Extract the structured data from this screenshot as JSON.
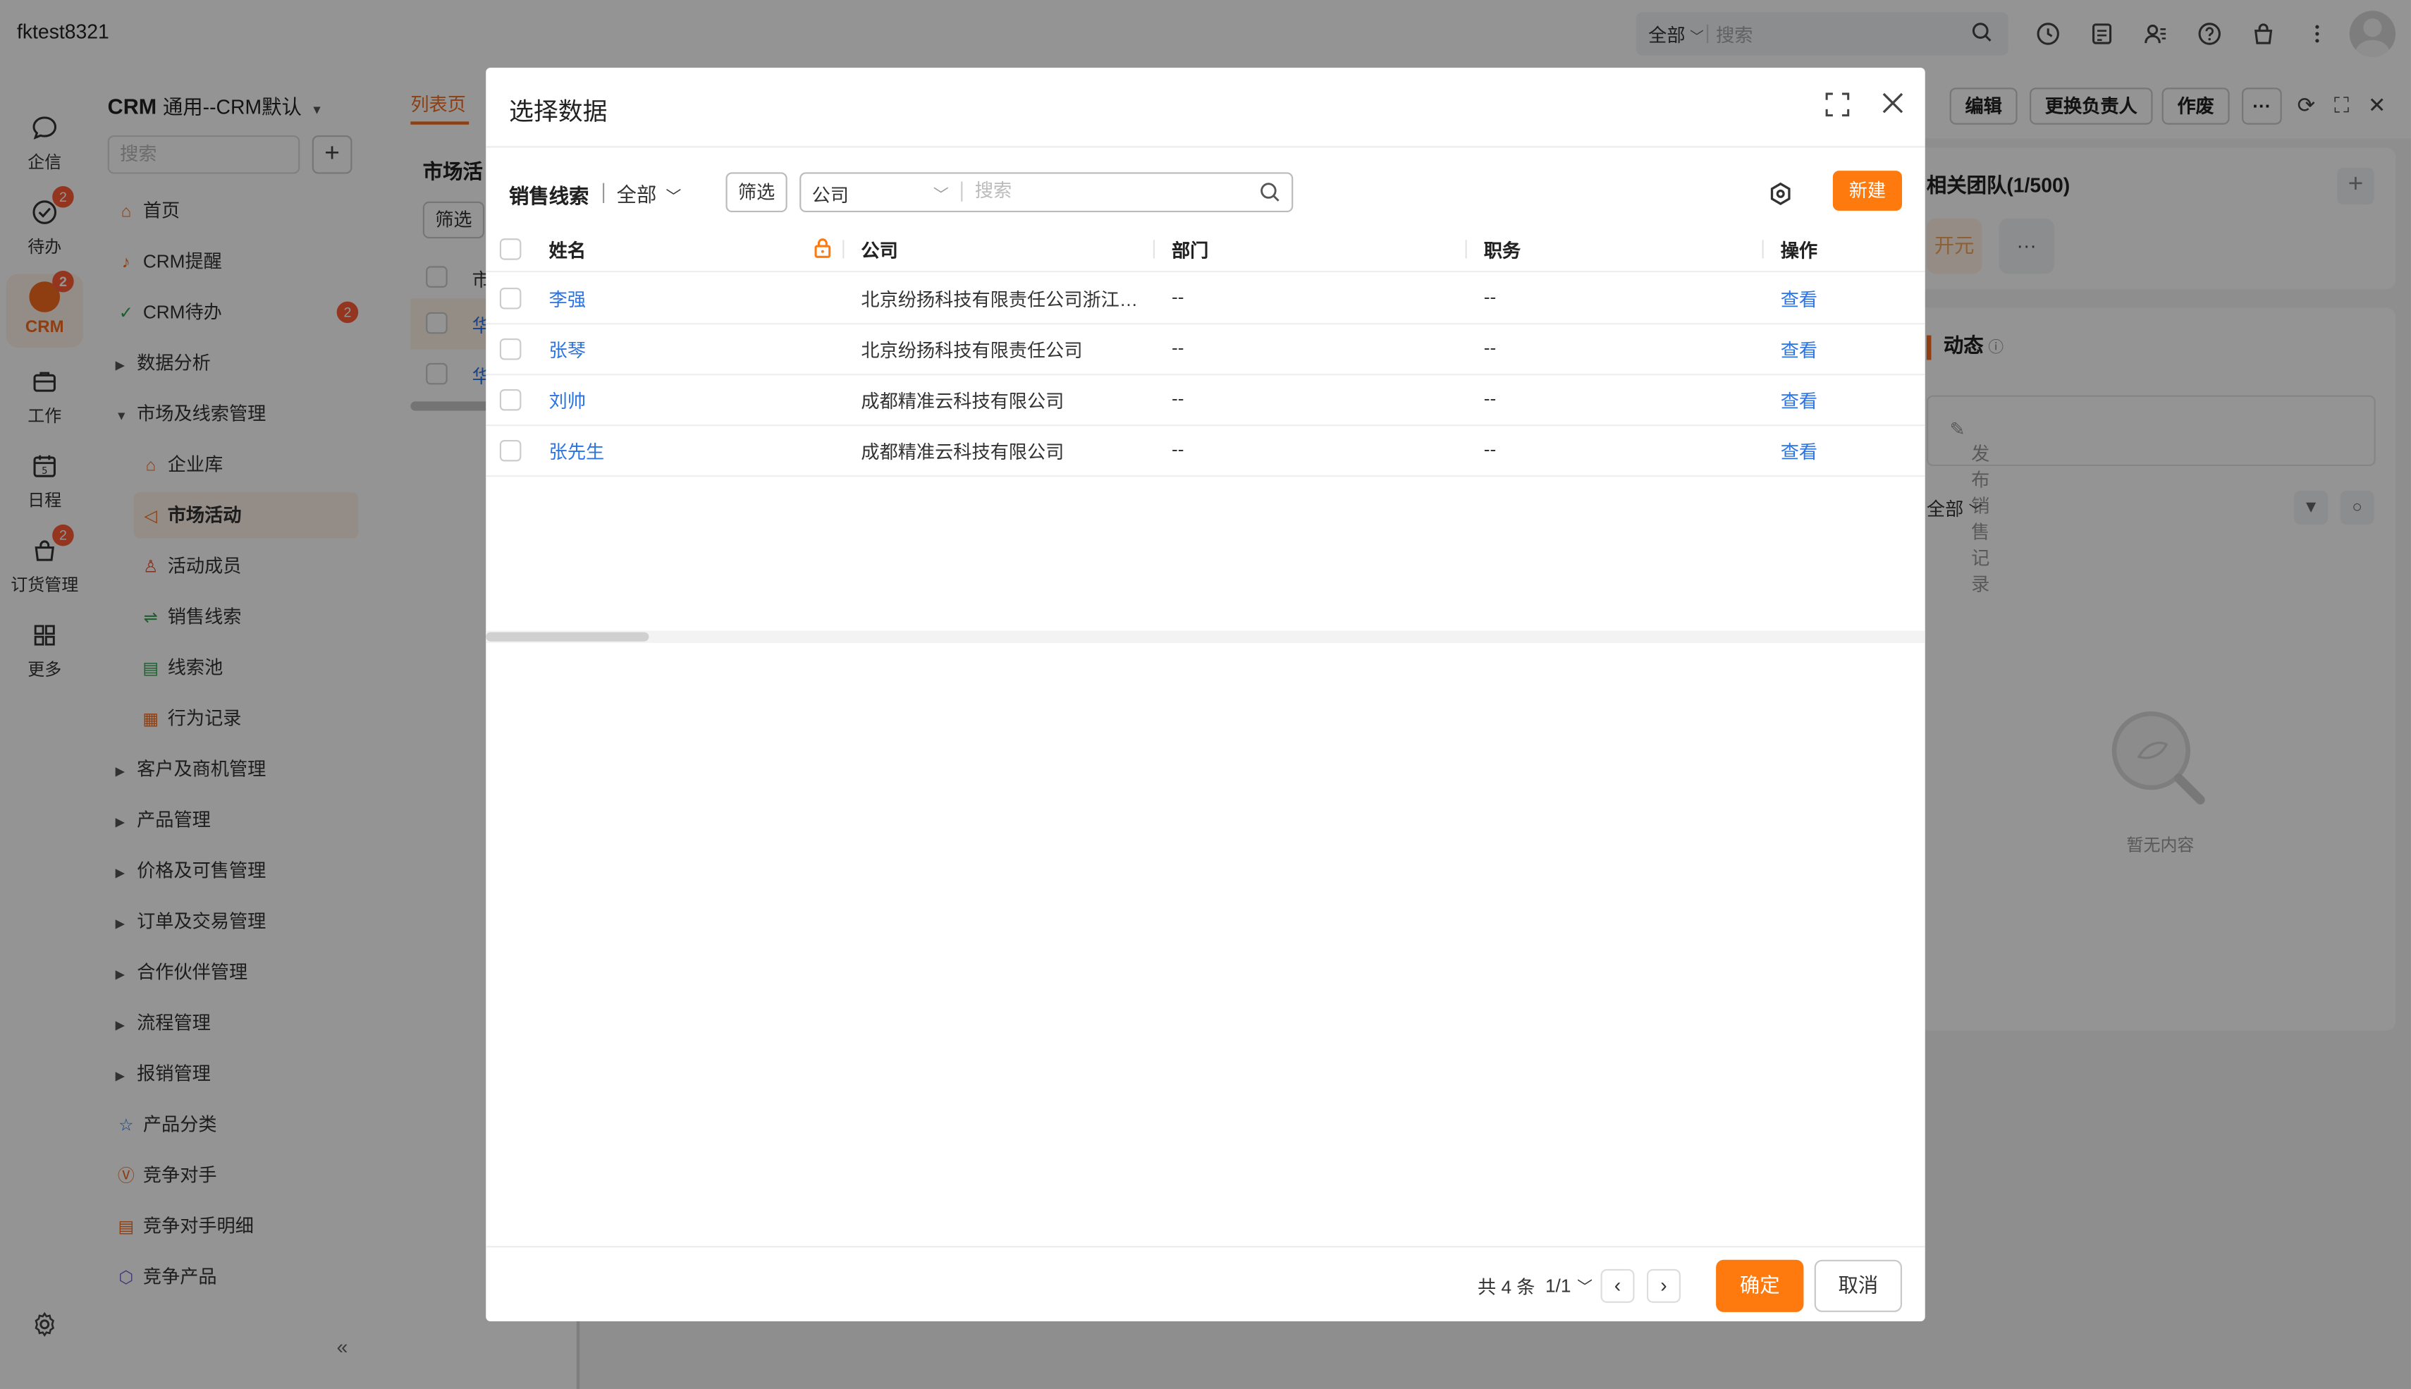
{
  "topbar": {
    "tenant": "fktest8321",
    "search_scope": "全部",
    "search_placeholder": "搜索",
    "icons": [
      "clock-icon",
      "notes-icon",
      "contacts-icon",
      "help-icon",
      "store-icon",
      "more-vertical-icon"
    ]
  },
  "rail": {
    "items": [
      {
        "label": "企信",
        "icon": "chat-icon",
        "badge": ""
      },
      {
        "label": "待办",
        "icon": "check-circle-icon",
        "badge": "2"
      },
      {
        "label": "CRM",
        "icon": "crm-icon",
        "badge": "2"
      },
      {
        "label": "工作",
        "icon": "briefcase-icon",
        "badge": ""
      },
      {
        "label": "日程",
        "icon": "calendar-icon",
        "badge": ""
      },
      {
        "label": "订货管理",
        "icon": "bag-icon",
        "badge": "2"
      },
      {
        "label": "更多",
        "icon": "grid-icon",
        "badge": ""
      }
    ]
  },
  "nav": {
    "title_bold": "CRM",
    "title_rest": "通用--CRM默认",
    "search_placeholder": "搜索",
    "items": [
      {
        "label": "首页",
        "icon": "home-icon",
        "level": 0,
        "expander": "",
        "badge": ""
      },
      {
        "label": "CRM提醒",
        "icon": "bell-icon",
        "level": 0,
        "expander": "",
        "badge": ""
      },
      {
        "label": "CRM待办",
        "icon": "check-circle-icon",
        "level": 0,
        "expander": "",
        "badge": "2"
      },
      {
        "label": "数据分析",
        "icon": "",
        "level": 0,
        "expander": "collapsed",
        "badge": ""
      },
      {
        "label": "市场及线索管理",
        "icon": "",
        "level": 0,
        "expander": "expanded",
        "badge": ""
      },
      {
        "label": "企业库",
        "icon": "building-icon",
        "level": 1,
        "expander": "",
        "badge": ""
      },
      {
        "label": "市场活动",
        "icon": "megaphone-icon",
        "level": 1,
        "expander": "",
        "badge": "",
        "active": true
      },
      {
        "label": "活动成员",
        "icon": "member-icon",
        "level": 1,
        "expander": "",
        "badge": ""
      },
      {
        "label": "销售线索",
        "icon": "funnel-icon",
        "level": 1,
        "expander": "",
        "badge": ""
      },
      {
        "label": "线索池",
        "icon": "pool-icon",
        "level": 1,
        "expander": "",
        "badge": ""
      },
      {
        "label": "行为记录",
        "icon": "record-icon",
        "level": 1,
        "expander": "",
        "badge": ""
      },
      {
        "label": "客户及商机管理",
        "icon": "",
        "level": 0,
        "expander": "collapsed",
        "badge": ""
      },
      {
        "label": "产品管理",
        "icon": "",
        "level": 0,
        "expander": "collapsed",
        "badge": ""
      },
      {
        "label": "价格及可售管理",
        "icon": "",
        "level": 0,
        "expander": "collapsed",
        "badge": ""
      },
      {
        "label": "订单及交易管理",
        "icon": "",
        "level": 0,
        "expander": "collapsed",
        "badge": ""
      },
      {
        "label": "合作伙伴管理",
        "icon": "",
        "level": 0,
        "expander": "collapsed",
        "badge": ""
      },
      {
        "label": "流程管理",
        "icon": "",
        "level": 0,
        "expander": "collapsed",
        "badge": ""
      },
      {
        "label": "报销管理",
        "icon": "",
        "level": 0,
        "expander": "collapsed",
        "badge": ""
      },
      {
        "label": "产品分类",
        "icon": "category-icon",
        "level": 0,
        "expander": "",
        "badge": ""
      },
      {
        "label": "竞争对手",
        "icon": "vs-icon",
        "level": 0,
        "expander": "",
        "badge": ""
      },
      {
        "label": "竞争对手明细",
        "icon": "detail-icon",
        "level": 0,
        "expander": "",
        "badge": ""
      },
      {
        "label": "竞争产品",
        "icon": "cube-icon",
        "level": 0,
        "expander": "",
        "badge": ""
      }
    ]
  },
  "list_page": {
    "tab": "列表页",
    "title": "市场活",
    "filter": "筛选",
    "rows": [
      "市",
      "华",
      "华"
    ]
  },
  "detail": {
    "buttons": [
      "编辑",
      "更换负责人",
      "作废",
      "···"
    ],
    "team_title": "相关团队(1/500)",
    "team_member": "开元",
    "team_more": "···",
    "activity_title": "动态",
    "activity_input": "发布销售记录",
    "activity_filter": "全部",
    "empty": "暂无内容"
  },
  "modal": {
    "title": "选择数据",
    "object_name": "销售线索",
    "scope": "全部",
    "filter_label": "筛选",
    "search_field": "公司",
    "search_placeholder": "搜索",
    "new_label": "新建",
    "columns": [
      "姓名",
      "公司",
      "部门",
      "职务",
      "操作"
    ],
    "rows": [
      {
        "name": "李强",
        "company": "北京纷扬科技有限责任公司浙江分公司",
        "department": "--",
        "title": "--",
        "action": "查看"
      },
      {
        "name": "张琴",
        "company": "北京纷扬科技有限责任公司",
        "department": "--",
        "title": "--",
        "action": "查看"
      },
      {
        "name": "刘帅",
        "company": "成都精准云科技有限公司",
        "department": "--",
        "title": "--",
        "action": "查看"
      },
      {
        "name": "张先生",
        "company": "成都精准云科技有限公司",
        "department": "--",
        "title": "--",
        "action": "查看"
      }
    ],
    "pagination": {
      "total": "共 4 条",
      "page": "1/1"
    },
    "confirm_label": "确定",
    "cancel_label": "取消"
  },
  "colors": {
    "accent": "#ff7a0e",
    "link": "#2b74e6",
    "badge": "#ff5c38"
  }
}
